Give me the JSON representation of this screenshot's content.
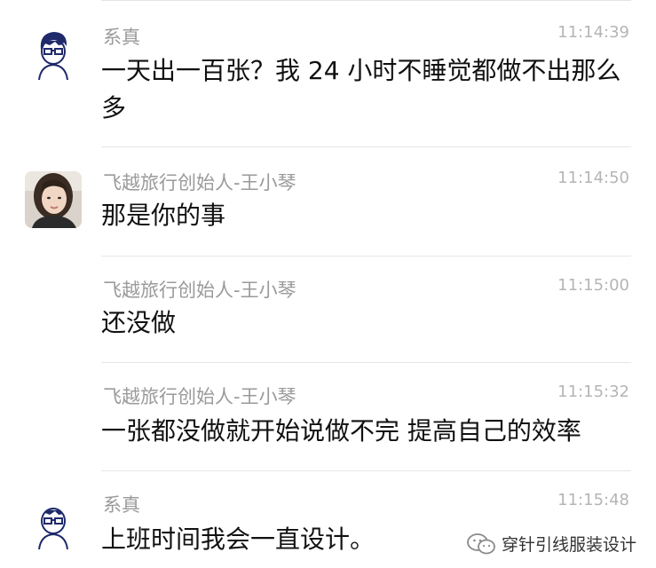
{
  "messages": [
    {
      "sender": "系真",
      "time": "11:14:39",
      "text": "一天出一百张？我 24 小时不睡觉都做不出那么多",
      "avatar": "cartoon-boy-avatar"
    },
    {
      "sender": "飞越旅行创始人-王小琴",
      "time": "11:14:50",
      "text": "那是你的事",
      "avatar": "woman-photo-avatar"
    },
    {
      "sender": "飞越旅行创始人-王小琴",
      "time": "11:15:00",
      "text": "还没做",
      "avatar": ""
    },
    {
      "sender": "飞越旅行创始人-王小琴",
      "time": "11:15:32",
      "text": "一张都没做就开始说做不完 提高自己的效率",
      "avatar": ""
    },
    {
      "sender": "系真",
      "time": "11:15:48",
      "text": "上班时间我会一直设计。",
      "avatar": "cartoon-boy-avatar"
    }
  ],
  "watermark": {
    "text": "穿针引线服装设计",
    "icon": "wechat-icon"
  },
  "colors": {
    "sender": "#9a9a9a",
    "time": "#b5b5b5",
    "text": "#111111",
    "divider": "#e6e6e6"
  }
}
